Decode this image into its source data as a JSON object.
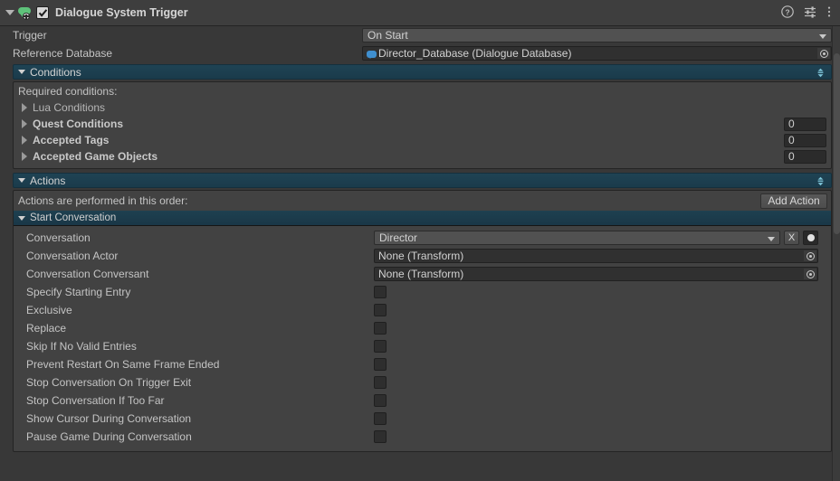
{
  "component": {
    "title": "Dialogue System Trigger",
    "enabled": true,
    "icon": "dialogue-system-component-icon",
    "header_icons": [
      "help-icon",
      "preset-icon",
      "more-menu-icon"
    ]
  },
  "properties": [
    {
      "label": "Trigger",
      "type": "popup",
      "value": "On Start"
    },
    {
      "label": "Reference Database",
      "type": "object",
      "value": "Director_Database (Dialogue Database)",
      "icon": "dialogue-database-icon"
    }
  ],
  "conditions": {
    "header": "Conditions",
    "note": "Required conditions:",
    "items": [
      {
        "label": "Lua Conditions",
        "bold": false,
        "count": null
      },
      {
        "label": "Quest Conditions",
        "bold": true,
        "count": "0"
      },
      {
        "label": "Accepted Tags",
        "bold": true,
        "count": "0"
      },
      {
        "label": "Accepted Game Objects",
        "bold": true,
        "count": "0"
      }
    ]
  },
  "actions": {
    "header": "Actions",
    "note": "Actions are performed in this order:",
    "add_button": "Add Action",
    "start_conversation": {
      "header": "Start Conversation",
      "fields": [
        {
          "label": "Conversation",
          "type": "popup-with-buttons",
          "value": "Director",
          "clear_button": "X"
        },
        {
          "label": "Conversation Actor",
          "type": "object",
          "value": "None (Transform)"
        },
        {
          "label": "Conversation Conversant",
          "type": "object",
          "value": "None (Transform)"
        },
        {
          "label": "Specify Starting Entry",
          "type": "checkbox",
          "checked": false
        },
        {
          "label": "Exclusive",
          "type": "checkbox",
          "checked": false
        },
        {
          "label": "Replace",
          "type": "checkbox",
          "checked": false
        },
        {
          "label": "Skip If No Valid Entries",
          "type": "checkbox",
          "checked": false
        },
        {
          "label": "Prevent Restart On Same Frame Ended",
          "type": "checkbox",
          "checked": false
        },
        {
          "label": "Stop Conversation On Trigger Exit",
          "type": "checkbox",
          "checked": false
        },
        {
          "label": "Stop Conversation If Too Far",
          "type": "checkbox",
          "checked": false
        },
        {
          "label": "Show Cursor During Conversation",
          "type": "checkbox",
          "checked": false
        },
        {
          "label": "Pause Game During Conversation",
          "type": "checkbox",
          "checked": false
        }
      ]
    }
  },
  "colors": {
    "background": "#383838",
    "header_bar": "#3e3e3e",
    "section_header_teal": "#1f4354",
    "group_box": "#424242",
    "accent_green": "#5ec27a",
    "accent_blue": "#3f8fcf"
  }
}
